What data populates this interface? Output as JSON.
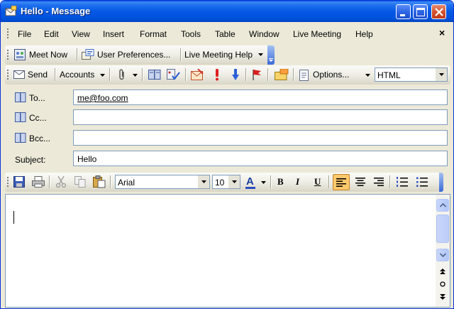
{
  "window": {
    "title": "Hello - Message"
  },
  "menu": {
    "items": [
      "File",
      "Edit",
      "View",
      "Insert",
      "Format",
      "Tools",
      "Table",
      "Window",
      "Live Meeting",
      "Help"
    ],
    "close_glyph": "×"
  },
  "toolbar_meeting": {
    "meet_now": "Meet Now",
    "user_preferences": "User Preferences...",
    "live_meeting_help": "Live Meeting Help"
  },
  "toolbar_send": {
    "send": "Send",
    "accounts": "Accounts",
    "options": "Options...",
    "format_value": "HTML"
  },
  "fields": {
    "to_label": "To...",
    "to_value": "me@foo.com",
    "cc_label": "Cc...",
    "cc_value": "",
    "bcc_label": "Bcc...",
    "bcc_value": "",
    "subject_label": "Subject:",
    "subject_value": "Hello"
  },
  "toolbar_format": {
    "font_name": "Arial",
    "font_size": "10",
    "font_color_letter": "A",
    "bold": "B",
    "italic": "I",
    "underline": "U"
  },
  "icons": {
    "accent": "#0053df",
    "close_button": "#d2502c"
  }
}
